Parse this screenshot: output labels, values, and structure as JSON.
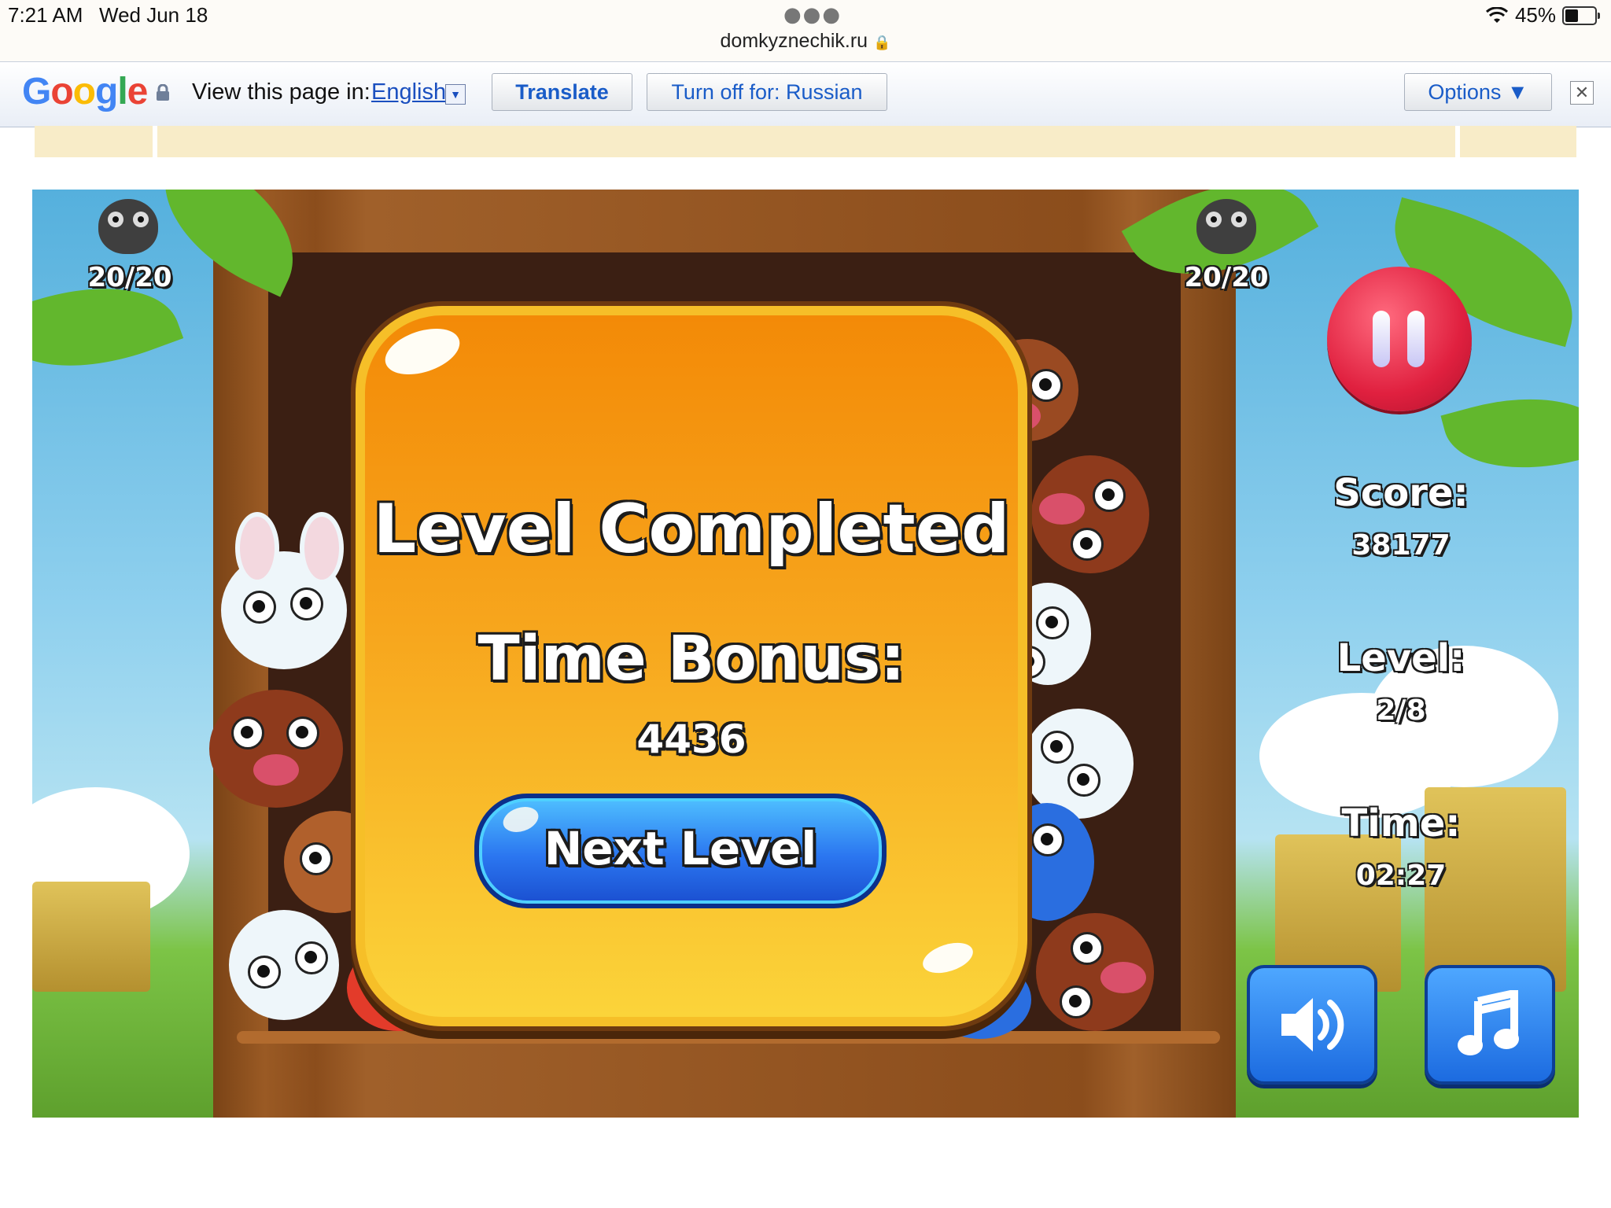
{
  "status_bar": {
    "time": "7:21 AM",
    "date": "Wed Jun 18",
    "url": "domkyznechik.ru",
    "battery": "45%"
  },
  "translate_bar": {
    "view_label": "View this page in:",
    "language": "English",
    "translate_label": "Translate",
    "turn_off_label": "Turn off for: Russian",
    "options_label": "Options ▼"
  },
  "hud": {
    "left_counter": "20/20",
    "right_counter": "20/20",
    "score_label": "Score:",
    "score_value": "38177",
    "level_label": "Level:",
    "level_value": "2/8",
    "time_label": "Time:",
    "time_value": "02:27"
  },
  "dialog": {
    "title": "Level Completed",
    "bonus_label": "Time Bonus:",
    "bonus_value": "4436",
    "next_button": "Next Level"
  },
  "colors": {
    "dialog_top": "#f38a07",
    "dialog_bottom": "#fbd43a",
    "next_button": "#2b76f0",
    "pause_button": "#e0203f"
  }
}
